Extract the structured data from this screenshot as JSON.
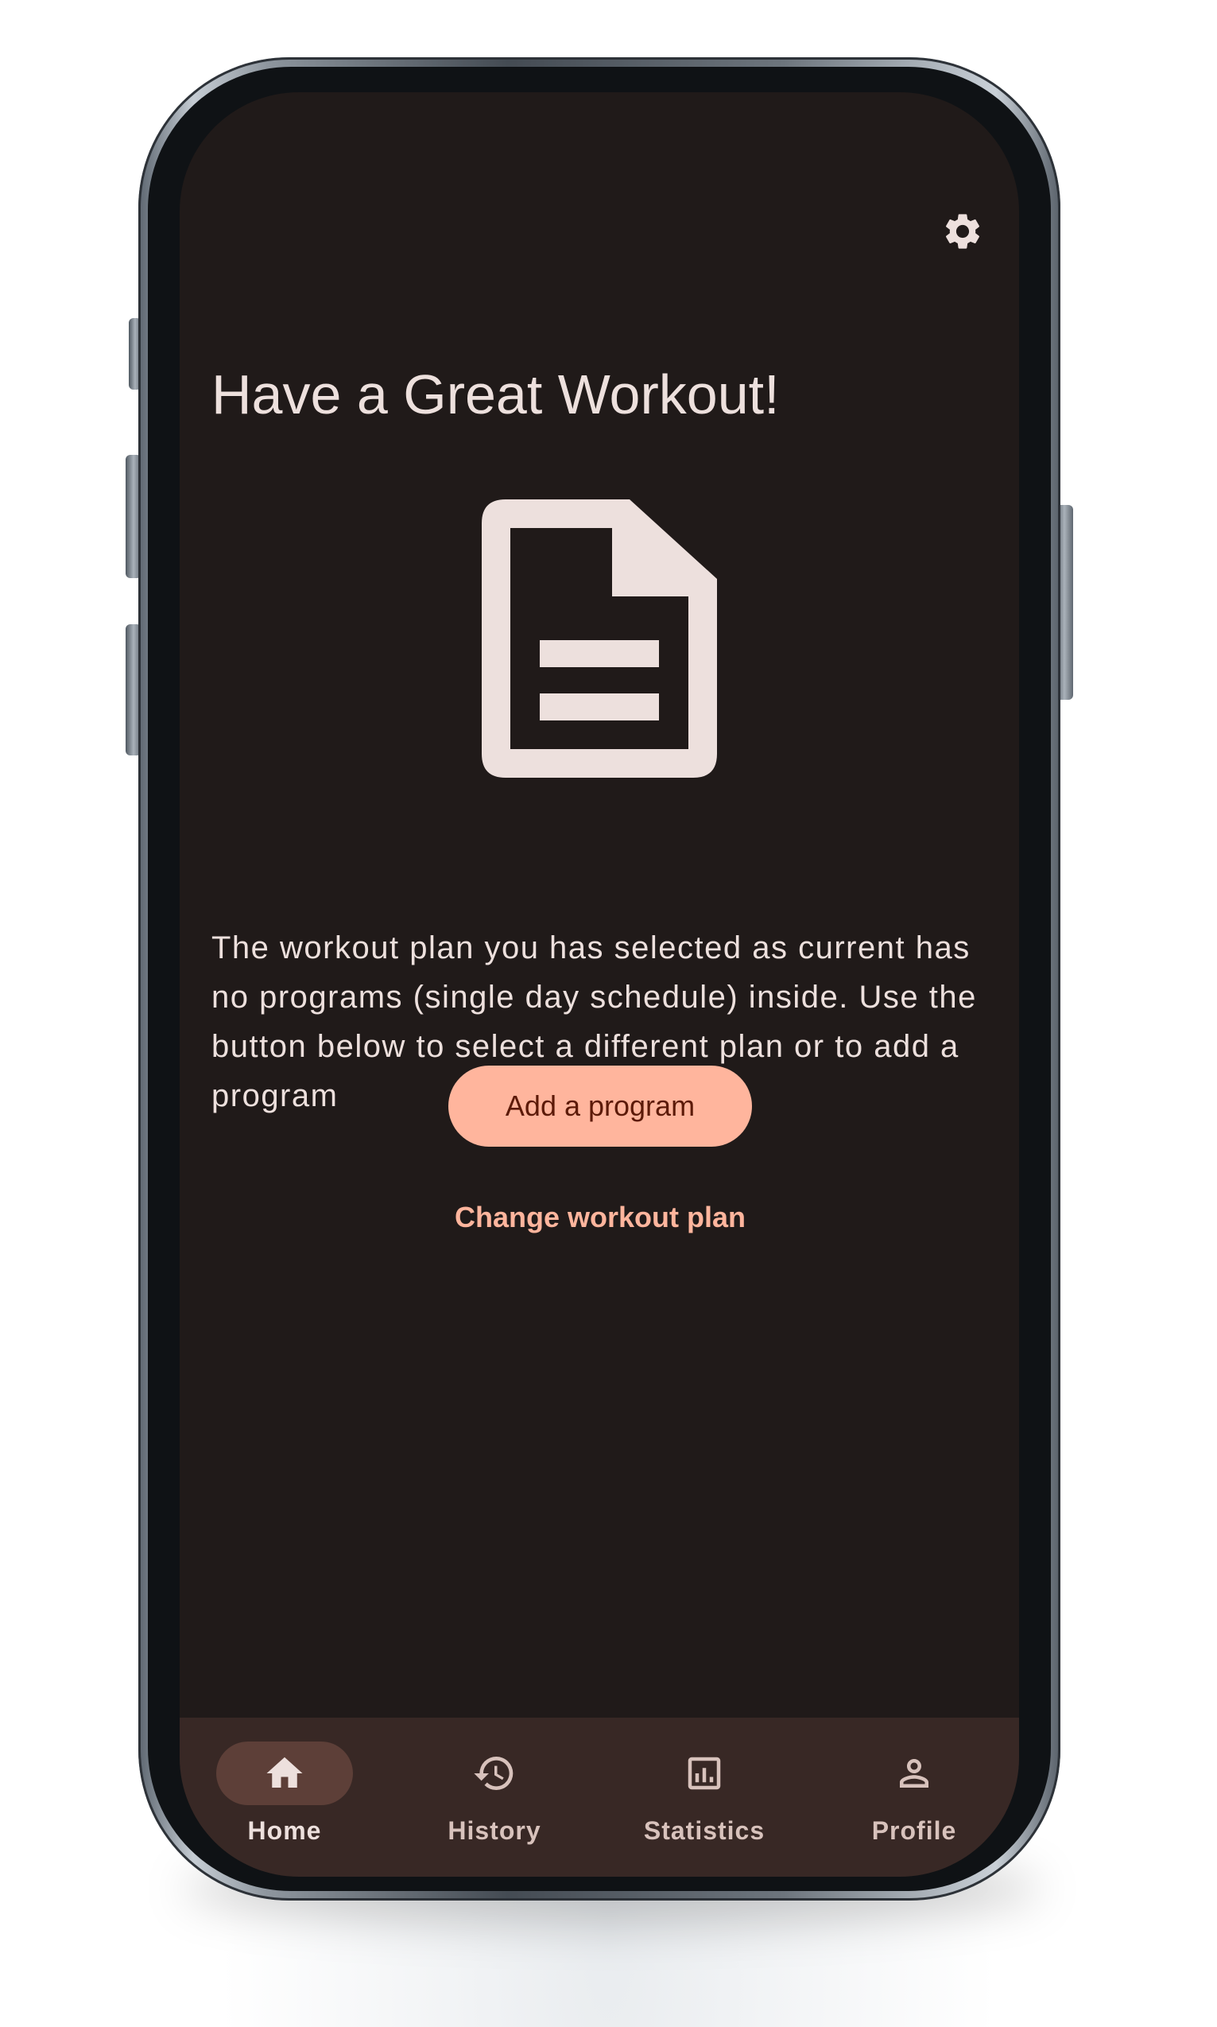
{
  "app": {
    "title": "Have a Great Workout!",
    "message": "The workout plan you has selected as current has no programs (single day schedule) inside. Use the button below to select a different plan or to add a program",
    "primary_action": "Add a program",
    "secondary_action": "Change workout plan",
    "icons": {
      "settings": "gear-icon",
      "empty_state": "document-icon"
    }
  },
  "bottom_nav": {
    "items": [
      {
        "label": "Home",
        "icon": "home-icon",
        "active": true
      },
      {
        "label": "History",
        "icon": "history-icon",
        "active": false
      },
      {
        "label": "Statistics",
        "icon": "statistics-icon",
        "active": false
      },
      {
        "label": "Profile",
        "icon": "profile-icon",
        "active": false
      }
    ]
  },
  "colors": {
    "background": "#201a19",
    "on_background": "#ede0dd",
    "primary": "#ffb59d",
    "on_primary": "#5c1a08",
    "nav_background": "#382825",
    "nav_active_pill": "#5d3f38"
  }
}
